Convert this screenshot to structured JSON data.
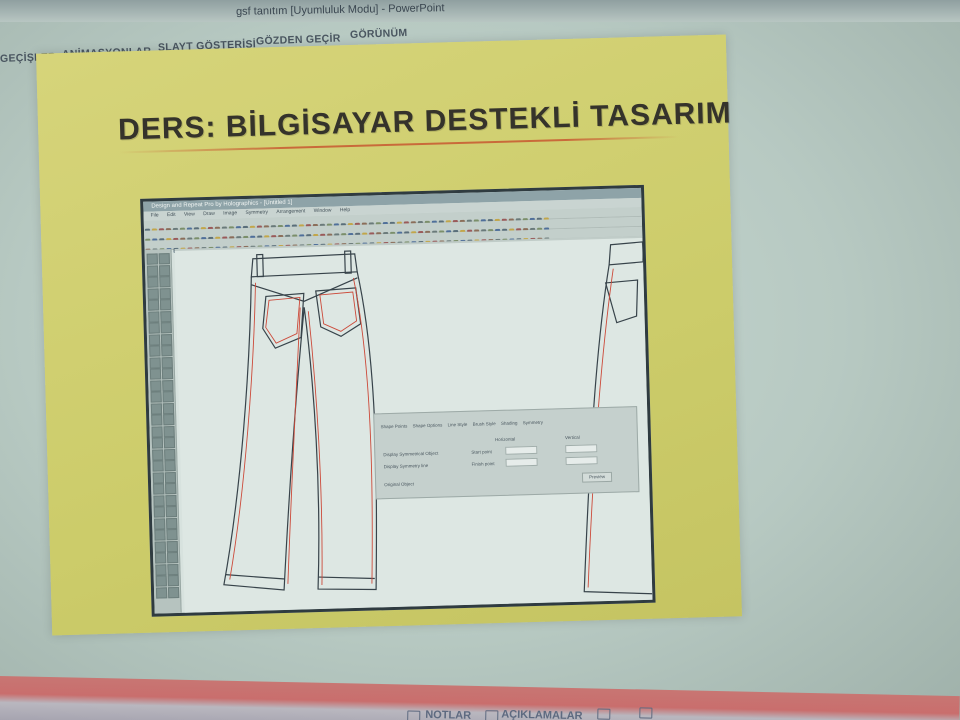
{
  "window": {
    "title": "gsf tanıtım [Uyumluluk Modu] - PowerPoint"
  },
  "ribbon": {
    "tabs": [
      "GEÇİŞLER",
      "ANİMASYONLAR",
      "SLAYT GÖSTERİSİ",
      "GÖZDEN GEÇİR",
      "GÖRÜNÜM"
    ]
  },
  "slide": {
    "title": "DERS: BİLGİSAYAR DESTEKLİ TASARIM",
    "background_color": "#d4d272",
    "screenshot": {
      "app_title": "Design and Repeat Pro by Holographics - [Untitled 1]",
      "menu": [
        "File",
        "Edit",
        "View",
        "Draw",
        "Image",
        "Symmetry",
        "Arrangement",
        "Window",
        "Help"
      ],
      "dialog": {
        "tabs": [
          "Shape Points",
          "Shape Options",
          "Line Style",
          "Brush Style",
          "Shading",
          "Symmetry"
        ],
        "labels": [
          "Display Symmetrical Object",
          "Display Symmetry line",
          "Original Object",
          "Horizontal",
          "Vertical",
          "Start point",
          "Finish point",
          "Preview"
        ]
      }
    }
  },
  "statusbar": {
    "notes_label": "NOTLAR",
    "comments_label": "AÇIKLAMALAR",
    "accent": "#c96e6d"
  }
}
